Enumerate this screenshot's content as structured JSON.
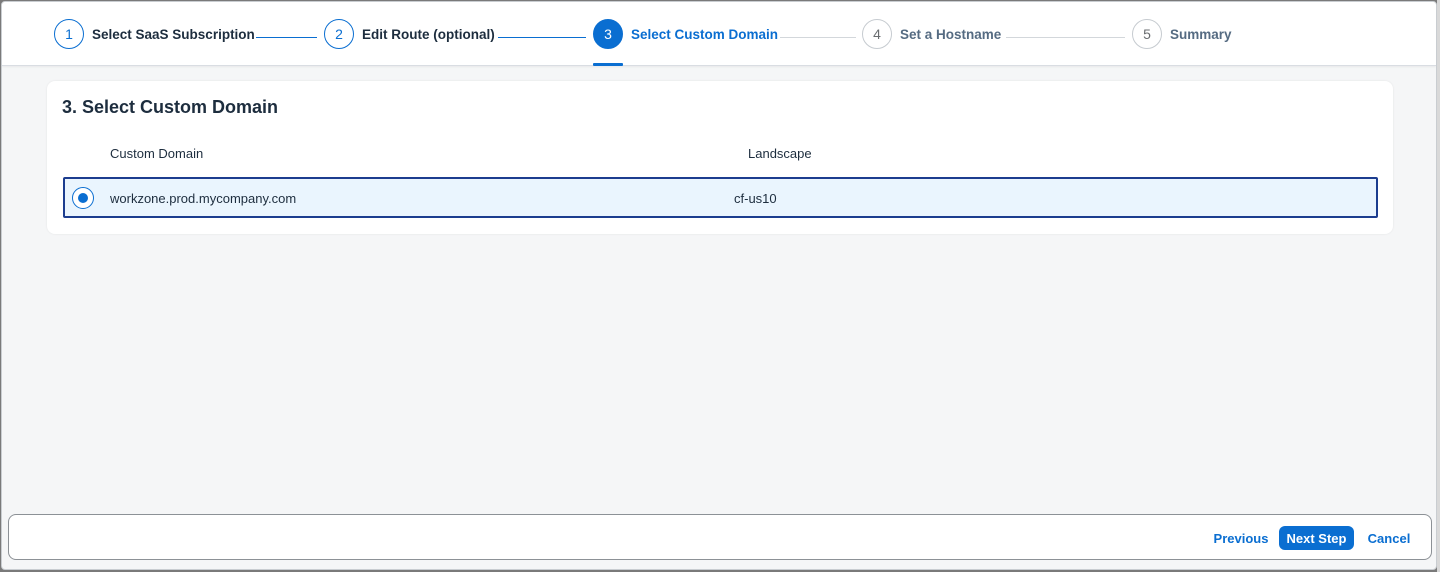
{
  "wizard": {
    "steps": [
      {
        "number": "1",
        "label": "Select SaaS Subscription",
        "state": "done"
      },
      {
        "number": "2",
        "label": "Edit Route (optional)",
        "state": "done"
      },
      {
        "number": "3",
        "label": "Select Custom Domain",
        "state": "active"
      },
      {
        "number": "4",
        "label": "Set a Hostname",
        "state": "future"
      },
      {
        "number": "5",
        "label": "Summary",
        "state": "future"
      }
    ]
  },
  "content": {
    "title": "3. Select Custom Domain",
    "table": {
      "columns": [
        "Custom Domain",
        "Landscape"
      ],
      "rows": [
        {
          "custom_domain": "workzone.prod.mycompany.com",
          "landscape": "cf-us10",
          "selected": true
        }
      ]
    }
  },
  "footer": {
    "previous_label": "Previous",
    "next_label": "Next Step",
    "cancel_label": "Cancel"
  },
  "colors": {
    "accent": "#0a6ed1",
    "selected_row_bg": "#eaf5fe",
    "selected_row_border": "#1c3d8f"
  }
}
